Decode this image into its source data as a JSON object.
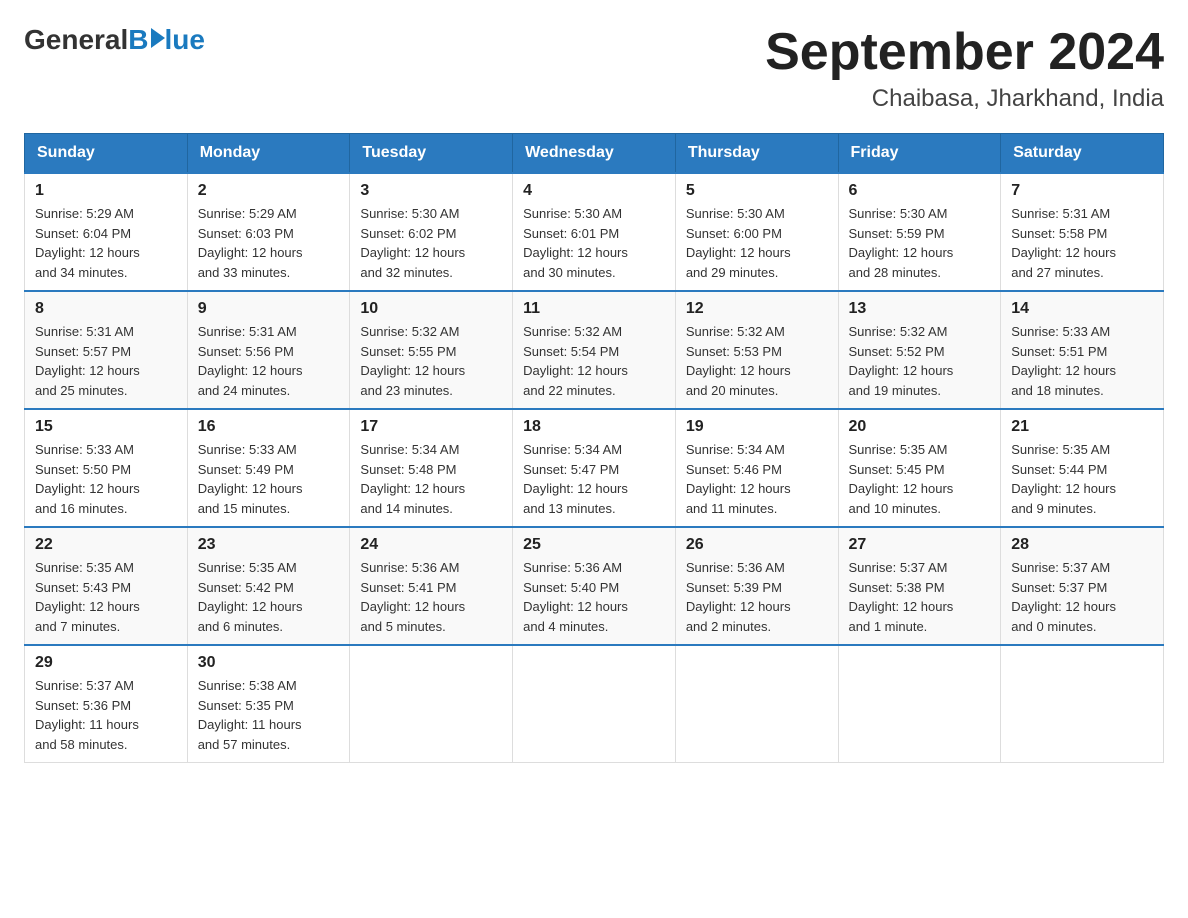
{
  "header": {
    "logo": {
      "general": "General",
      "blue": "Blue"
    },
    "title": "September 2024",
    "location": "Chaibasa, Jharkhand, India"
  },
  "days_of_week": [
    "Sunday",
    "Monday",
    "Tuesday",
    "Wednesday",
    "Thursday",
    "Friday",
    "Saturday"
  ],
  "weeks": [
    [
      {
        "day": "1",
        "sunrise": "5:29 AM",
        "sunset": "6:04 PM",
        "daylight": "12 hours and 34 minutes."
      },
      {
        "day": "2",
        "sunrise": "5:29 AM",
        "sunset": "6:03 PM",
        "daylight": "12 hours and 33 minutes."
      },
      {
        "day": "3",
        "sunrise": "5:30 AM",
        "sunset": "6:02 PM",
        "daylight": "12 hours and 32 minutes."
      },
      {
        "day": "4",
        "sunrise": "5:30 AM",
        "sunset": "6:01 PM",
        "daylight": "12 hours and 30 minutes."
      },
      {
        "day": "5",
        "sunrise": "5:30 AM",
        "sunset": "6:00 PM",
        "daylight": "12 hours and 29 minutes."
      },
      {
        "day": "6",
        "sunrise": "5:30 AM",
        "sunset": "5:59 PM",
        "daylight": "12 hours and 28 minutes."
      },
      {
        "day": "7",
        "sunrise": "5:31 AM",
        "sunset": "5:58 PM",
        "daylight": "12 hours and 27 minutes."
      }
    ],
    [
      {
        "day": "8",
        "sunrise": "5:31 AM",
        "sunset": "5:57 PM",
        "daylight": "12 hours and 25 minutes."
      },
      {
        "day": "9",
        "sunrise": "5:31 AM",
        "sunset": "5:56 PM",
        "daylight": "12 hours and 24 minutes."
      },
      {
        "day": "10",
        "sunrise": "5:32 AM",
        "sunset": "5:55 PM",
        "daylight": "12 hours and 23 minutes."
      },
      {
        "day": "11",
        "sunrise": "5:32 AM",
        "sunset": "5:54 PM",
        "daylight": "12 hours and 22 minutes."
      },
      {
        "day": "12",
        "sunrise": "5:32 AM",
        "sunset": "5:53 PM",
        "daylight": "12 hours and 20 minutes."
      },
      {
        "day": "13",
        "sunrise": "5:32 AM",
        "sunset": "5:52 PM",
        "daylight": "12 hours and 19 minutes."
      },
      {
        "day": "14",
        "sunrise": "5:33 AM",
        "sunset": "5:51 PM",
        "daylight": "12 hours and 18 minutes."
      }
    ],
    [
      {
        "day": "15",
        "sunrise": "5:33 AM",
        "sunset": "5:50 PM",
        "daylight": "12 hours and 16 minutes."
      },
      {
        "day": "16",
        "sunrise": "5:33 AM",
        "sunset": "5:49 PM",
        "daylight": "12 hours and 15 minutes."
      },
      {
        "day": "17",
        "sunrise": "5:34 AM",
        "sunset": "5:48 PM",
        "daylight": "12 hours and 14 minutes."
      },
      {
        "day": "18",
        "sunrise": "5:34 AM",
        "sunset": "5:47 PM",
        "daylight": "12 hours and 13 minutes."
      },
      {
        "day": "19",
        "sunrise": "5:34 AM",
        "sunset": "5:46 PM",
        "daylight": "12 hours and 11 minutes."
      },
      {
        "day": "20",
        "sunrise": "5:35 AM",
        "sunset": "5:45 PM",
        "daylight": "12 hours and 10 minutes."
      },
      {
        "day": "21",
        "sunrise": "5:35 AM",
        "sunset": "5:44 PM",
        "daylight": "12 hours and 9 minutes."
      }
    ],
    [
      {
        "day": "22",
        "sunrise": "5:35 AM",
        "sunset": "5:43 PM",
        "daylight": "12 hours and 7 minutes."
      },
      {
        "day": "23",
        "sunrise": "5:35 AM",
        "sunset": "5:42 PM",
        "daylight": "12 hours and 6 minutes."
      },
      {
        "day": "24",
        "sunrise": "5:36 AM",
        "sunset": "5:41 PM",
        "daylight": "12 hours and 5 minutes."
      },
      {
        "day": "25",
        "sunrise": "5:36 AM",
        "sunset": "5:40 PM",
        "daylight": "12 hours and 4 minutes."
      },
      {
        "day": "26",
        "sunrise": "5:36 AM",
        "sunset": "5:39 PM",
        "daylight": "12 hours and 2 minutes."
      },
      {
        "day": "27",
        "sunrise": "5:37 AM",
        "sunset": "5:38 PM",
        "daylight": "12 hours and 1 minute."
      },
      {
        "day": "28",
        "sunrise": "5:37 AM",
        "sunset": "5:37 PM",
        "daylight": "12 hours and 0 minutes."
      }
    ],
    [
      {
        "day": "29",
        "sunrise": "5:37 AM",
        "sunset": "5:36 PM",
        "daylight": "11 hours and 58 minutes."
      },
      {
        "day": "30",
        "sunrise": "5:38 AM",
        "sunset": "5:35 PM",
        "daylight": "11 hours and 57 minutes."
      },
      null,
      null,
      null,
      null,
      null
    ]
  ],
  "labels": {
    "sunrise": "Sunrise:",
    "sunset": "Sunset:",
    "daylight": "Daylight:"
  }
}
